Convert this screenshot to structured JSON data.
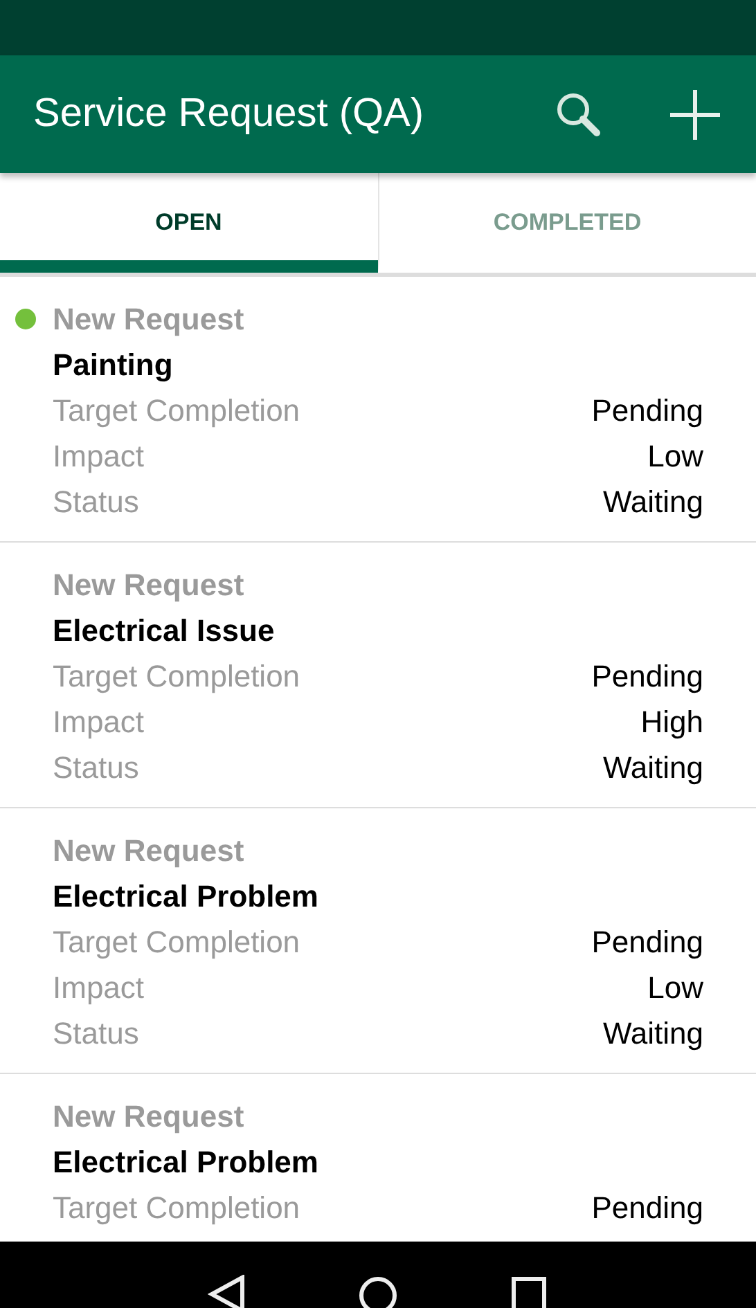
{
  "app_bar": {
    "title": "Service Request (QA)"
  },
  "tabs": [
    {
      "label": "OPEN",
      "selected": true
    },
    {
      "label": "COMPLETED",
      "selected": false
    }
  ],
  "requests": [
    {
      "type": "New Request",
      "unread": true,
      "title": "Painting",
      "fields": [
        {
          "label": "Target Completion",
          "value": "Pending"
        },
        {
          "label": "Impact",
          "value": "Low"
        },
        {
          "label": "Status",
          "value": "Waiting"
        }
      ]
    },
    {
      "type": "New Request",
      "unread": false,
      "title": "Electrical Issue",
      "fields": [
        {
          "label": "Target Completion",
          "value": "Pending"
        },
        {
          "label": "Impact",
          "value": "High"
        },
        {
          "label": "Status",
          "value": "Waiting"
        }
      ]
    },
    {
      "type": "New Request",
      "unread": false,
      "title": "Electrical Problem",
      "fields": [
        {
          "label": "Target Completion",
          "value": "Pending"
        },
        {
          "label": "Impact",
          "value": "Low"
        },
        {
          "label": "Status",
          "value": "Waiting"
        }
      ]
    },
    {
      "type": "New Request",
      "unread": false,
      "title": "Electrical Problem",
      "fields": [
        {
          "label": "Target Completion",
          "value": "Pending"
        }
      ]
    }
  ]
}
